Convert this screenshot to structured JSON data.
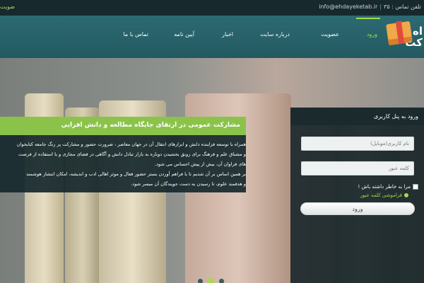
{
  "topbar": {
    "email": "info@ehdayeketab.ir",
    "phone": "تلفن تماس : ۳۵",
    "separator": "|",
    "membership_link": "ضویت"
  },
  "header": {
    "logo_text": "اه\nکت",
    "nav": [
      {
        "label": "ورود",
        "active": true
      },
      {
        "label": "عضویت",
        "active": false
      },
      {
        "label": "درباره سایت",
        "active": false
      },
      {
        "label": "اخبار",
        "active": false
      },
      {
        "label": "آیین نامه",
        "active": false
      },
      {
        "label": "تماس با ما",
        "active": false
      }
    ]
  },
  "info_card": {
    "title": "مشارکت عمومی در ارتقای جایگاه مطالعه و دانش افزایی",
    "lines": [
      "همراه با توسعه فزاینده دانش و ابزارهای انتقال آن در جهان معاصر ، ضرورت حضور و مشارکت پر رنگ جامعه کتابخوان",
      "و مشتاق علم و فرهنگ برای رونق بخشیدن دوباره به بازار تبادل دانش و آگاهی در فضای مجازی و با استفاده از فرصت",
      "های فراوان آن، بیش از پیش احساس می شود.",
      "بر همین اساس بر آن شدیم تا با فراهم آوردن بستر حضور فعال و موثر اهالی ادب و اندیشه، امکان انتشار هوشمند",
      "و هدفمند علوم، تا رسیدن به دست جویندگان آن میسر شود."
    ]
  },
  "login": {
    "title": "ورود به پنل کاربری",
    "username_placeholder": "نام کاربری(موبایل)",
    "password_placeholder": "کلمه عبور",
    "remember_label": "مرا به خاطر داشته باش !",
    "forgot_label": "فراموشی کلمه عبور",
    "submit_label": "ورود"
  },
  "slider": {
    "count": 3,
    "active_index": 1
  },
  "colors": {
    "accent_green": "#8bc34a",
    "header_teal": "#2c6a72",
    "dark_bar": "#17292d"
  }
}
